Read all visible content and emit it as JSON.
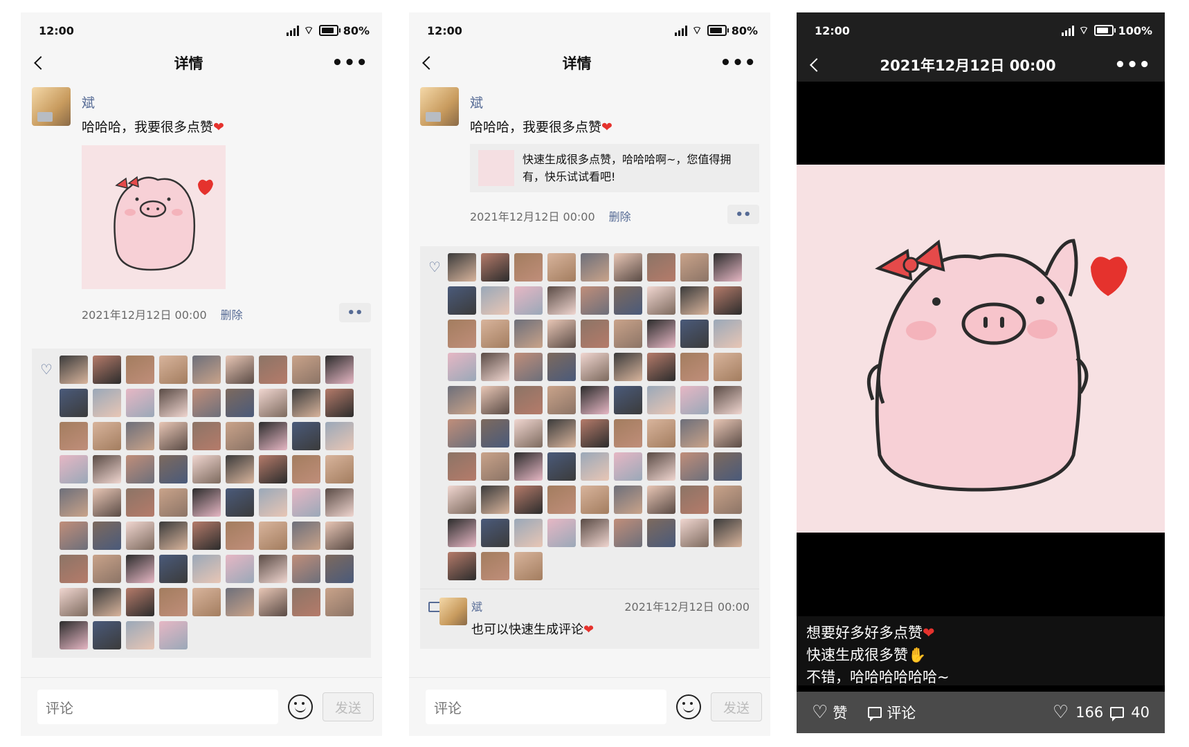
{
  "status": {
    "time": "12:00",
    "battery_p1": "80%",
    "battery_p2": "80%",
    "battery_p3": "100%"
  },
  "detail": {
    "title": "详情",
    "more": "•••"
  },
  "post": {
    "author": "斌",
    "text": "哈哈哈，我要很多点赞",
    "time": "2021年12月12日 00:00",
    "delete": "删除",
    "more_btn": "••",
    "link_text": "快速生成很多点赞，哈哈哈啊~，您值得拥有，快乐试试看吧!"
  },
  "comment": {
    "author": "斌",
    "time": "2021年12月12日 00:00",
    "text": "也可以快速生成评论"
  },
  "composer": {
    "placeholder": "评论",
    "send": "发送"
  },
  "viewer": {
    "title": "2021年12月12日 00:00",
    "caption": [
      "想要好多好多点赞",
      "快速生成很多赞",
      "不错，哈哈哈哈哈哈~"
    ],
    "like_label": "赞",
    "comment_label": "评论",
    "like_count": "166",
    "comment_count": "40"
  },
  "avatar_counts": {
    "p1": 76,
    "p2": 84
  },
  "colors": {
    "link": "#566b95",
    "heart": "#e5322d",
    "pig_bg": "#f7e3e5"
  }
}
